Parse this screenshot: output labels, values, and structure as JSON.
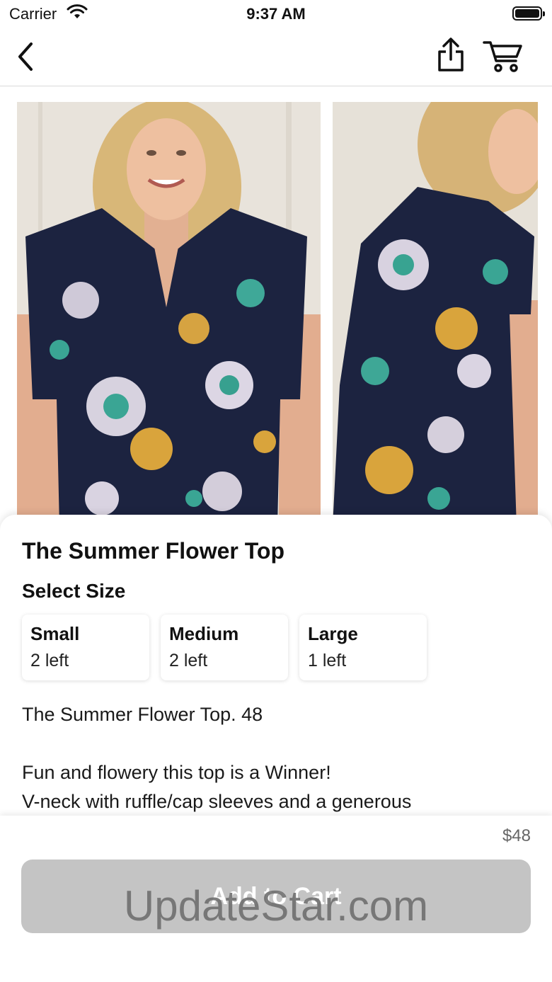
{
  "status_bar": {
    "carrier": "Carrier",
    "time": "9:37 AM"
  },
  "nav": {
    "back_icon": "chevron-left-icon",
    "share_icon": "share-icon",
    "cart_icon": "cart-icon"
  },
  "product": {
    "title": "The Summer Flower Top",
    "select_size_label": "Select Size",
    "sizes": [
      {
        "name": "Small",
        "stock": "2 left"
      },
      {
        "name": "Medium",
        "stock": "2 left"
      },
      {
        "name": "Large",
        "stock": "1 left"
      }
    ],
    "description": "The Summer Flower Top. 48\n\nFun and flowery this top is a Winner!\nV-neck with ruffle/cap sleeves and a generous"
  },
  "footer": {
    "price": "$48",
    "add_to_cart_label": "Add to Cart",
    "watermark": "UpdateStar.com"
  },
  "colors": {
    "top_navy": "#1c2340",
    "button_disabled": "#c4c4c4",
    "backdrop": "#e9e5df"
  }
}
